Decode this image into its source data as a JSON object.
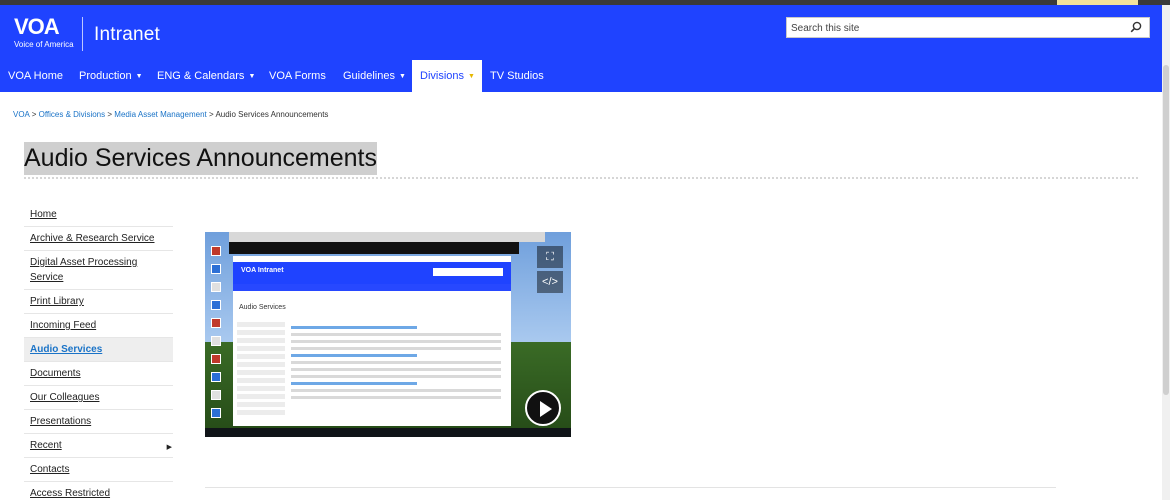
{
  "header": {
    "logo_mark": "VOA",
    "logo_sub": "Voice of America",
    "site_name": "Intranet",
    "search_placeholder": "Search this site",
    "brand_color": "#1f43ff"
  },
  "nav": {
    "items": [
      {
        "label": "VOA Home",
        "caret": ""
      },
      {
        "label": "Production",
        "caret": "▼"
      },
      {
        "label": "ENG & Calendars",
        "caret": "▼"
      },
      {
        "label": "VOA Forms",
        "caret": ""
      },
      {
        "label": "Guidelines",
        "caret": "▼"
      },
      {
        "label": "Divisions",
        "caret": "▼"
      },
      {
        "label": "TV Studios",
        "caret": ""
      }
    ],
    "active": "Divisions"
  },
  "breadcrumb": {
    "items": [
      "VOA",
      "Offices & Divisions",
      "Media Asset Management"
    ],
    "separator": ">",
    "current": "Audio Services Announcements"
  },
  "page": {
    "title": "Audio Services Announcements"
  },
  "sidenav": {
    "items": [
      {
        "label": "Home"
      },
      {
        "label": "Archive & Research Service"
      },
      {
        "label": "Digital Asset Processing Service"
      },
      {
        "label": "Print Library"
      },
      {
        "label": "Incoming Feed"
      },
      {
        "label": "Audio Services"
      },
      {
        "label": "Documents"
      },
      {
        "label": "Our Colleagues"
      },
      {
        "label": "Presentations"
      },
      {
        "label": "Recent",
        "arrow": "▶"
      },
      {
        "label": "Contacts"
      },
      {
        "label": "Access Restricted"
      }
    ],
    "active": "Audio Services"
  },
  "video": {
    "inner_site": "VOA Intranet",
    "inner_title": "Audio Services",
    "fullscreen_icon": "⛶",
    "embed_icon": "</>"
  }
}
